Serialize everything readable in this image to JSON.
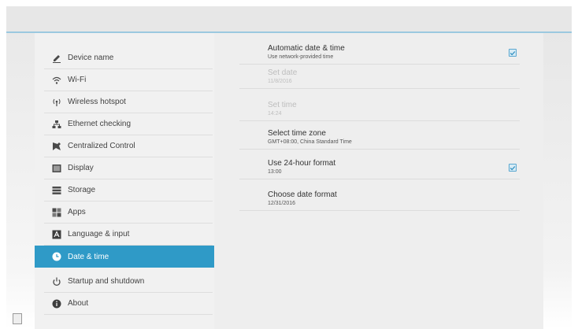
{
  "sidebar": {
    "items": [
      {
        "label": "Device name"
      },
      {
        "label": "Wi-Fi"
      },
      {
        "label": "Wireless hotspot"
      },
      {
        "label": "Ethernet checking"
      },
      {
        "label": "Centralized Control"
      },
      {
        "label": "Display"
      },
      {
        "label": "Storage"
      },
      {
        "label": "Apps"
      },
      {
        "label": "Language & input"
      },
      {
        "label": "Date & time"
      },
      {
        "label": "Startup and shutdown"
      },
      {
        "label": "About"
      }
    ],
    "active_item": "Date & time",
    "accent_color": "#2f9ac7"
  },
  "settings": {
    "automatic": {
      "title": "Automatic date & time",
      "subtitle": "Use network-provided time",
      "checked": true
    },
    "set_date": {
      "title": "Set date",
      "subtitle": "11/8/2016",
      "enabled": false
    },
    "set_time": {
      "title": "Set time",
      "subtitle": "14:24",
      "enabled": false
    },
    "time_zone": {
      "title": "Select time zone",
      "subtitle": "GMT+08:00, China Standard Time"
    },
    "hour24": {
      "title": "Use 24-hour format",
      "subtitle": "13:00",
      "checked": true
    },
    "date_format": {
      "title": "Choose date format",
      "subtitle": "12/31/2016"
    }
  },
  "icons": {
    "device_name": "pencil-icon",
    "wifi": "wifi-icon",
    "hotspot": "hotspot-icon",
    "ethernet": "network-icon",
    "centralized": "control-icon",
    "display": "display-icon",
    "storage": "storage-icon",
    "apps": "apps-icon",
    "language": "keyboard-icon",
    "date": "clock-icon",
    "startup": "power-icon",
    "about": "info-icon",
    "corner": "screenshot-icon"
  }
}
